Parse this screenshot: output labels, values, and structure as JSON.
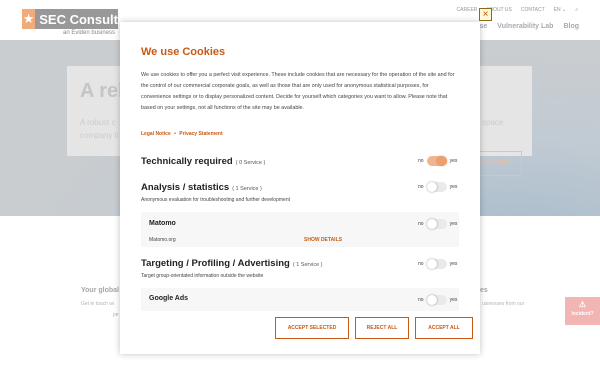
{
  "site": {
    "logo_text": "SEC Consult",
    "logo_sub": "an Eviden business",
    "top_nav": [
      "CAREER",
      "ABOUT US",
      "CONTACT",
      "EN ⌄",
      "⌕"
    ],
    "main_nav": [
      "...ourse",
      "Vulnerability Lab",
      "Blog"
    ],
    "hero_title": "A rel",
    "hero_text_line1": "A robust c",
    "hero_text_line2": "company ti",
    "hero_text_right": "space",
    "hero_button": "READ MORE",
    "section_left_title": "Your global",
    "section_left_text1": "Get in touch wi",
    "section_left_text2": "pe",
    "section_right_title": "es",
    "section_right_text": "usinesses from our",
    "incident_label": "Incident?"
  },
  "cookie_modal": {
    "title": "We use Cookies",
    "description": "We use cookies to offer you a perfect visit experience. These include cookies that are necessary for the operation of the site and for the control of our commercial corporate goals, as well as those that are only used for anonymous statistical purposes, for convenience settings or to display personalized content. Decide for yourself which categories you want to allow. Please note that based on your settings, not all functions of the site may be available.",
    "legal_notice": "Legal Notice",
    "separator": "•",
    "privacy_statement": "Privacy Statement",
    "close_icon": "close-icon",
    "toggle_no": "no",
    "toggle_yes": "yes",
    "categories": [
      {
        "title": "Technically required",
        "count": "( 0 Service )",
        "subtitle": "",
        "enabled": true
      },
      {
        "title": "Analysis / statistics",
        "count": "( 1 Service )",
        "subtitle": "Anonymous evaluation for troubleshooting and further development",
        "enabled": false,
        "services": [
          {
            "name": "Matomo",
            "url": "Matomo.org",
            "details": "SHOW DETAILS",
            "enabled": false
          }
        ]
      },
      {
        "title": "Targeting / Profiling / Advertising",
        "count": "( 1 Service )",
        "subtitle": "Target group-orientated information outside the website",
        "enabled": false,
        "services": [
          {
            "name": "Google Ads",
            "enabled": false
          }
        ]
      }
    ],
    "buttons": {
      "accept_selected": "ACCEPT SELECTED",
      "reject_all": "REJECT ALL",
      "accept_all": "ACCEPT ALL"
    },
    "accent_color": "#c85a14"
  }
}
